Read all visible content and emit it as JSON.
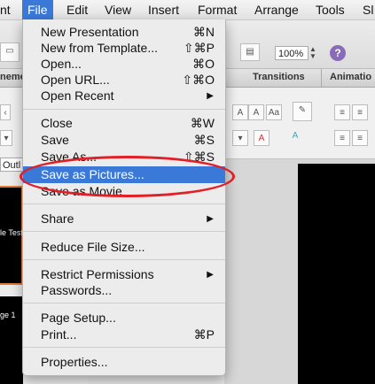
{
  "menubar": {
    "items": [
      "nt",
      "File",
      "Edit",
      "View",
      "Insert",
      "Format",
      "Arrange",
      "Tools",
      "Sl"
    ]
  },
  "toolbar": {
    "zoom": "100%",
    "help": "?"
  },
  "ribbon_tabs": [
    "neme",
    "Transitions",
    "Animatio"
  ],
  "outline_tab": "Outl",
  "slides": {
    "thumb1_text": "le Test",
    "thumb2_text": "ge 1"
  },
  "file_menu": {
    "items": [
      {
        "label": "New Presentation",
        "shortcut": "⌘N"
      },
      {
        "label": "New from Template...",
        "shortcut": "⇧⌘P"
      },
      {
        "label": "Open...",
        "shortcut": "⌘O"
      },
      {
        "label": "Open URL...",
        "shortcut": "⇧⌘O"
      },
      {
        "label": "Open Recent",
        "submenu": true
      },
      {
        "label": "Close",
        "shortcut": "⌘W"
      },
      {
        "label": "Save",
        "shortcut": "⌘S"
      },
      {
        "label": "Save As...",
        "shortcut": "⇧⌘S"
      },
      {
        "label": "Save as Pictures...",
        "highlighted": true
      },
      {
        "label": "Save as Movie"
      },
      {
        "label": "Share",
        "submenu": true
      },
      {
        "label": "Reduce File Size..."
      },
      {
        "label": "Restrict Permissions",
        "submenu": true
      },
      {
        "label": "Passwords..."
      },
      {
        "label": "Page Setup..."
      },
      {
        "label": "Print...",
        "shortcut": "⌘P"
      },
      {
        "label": "Properties..."
      }
    ]
  },
  "colors": {
    "highlight": "#3a79d8",
    "annotation": "#e31e24",
    "thumb_border": "#e07b39"
  }
}
